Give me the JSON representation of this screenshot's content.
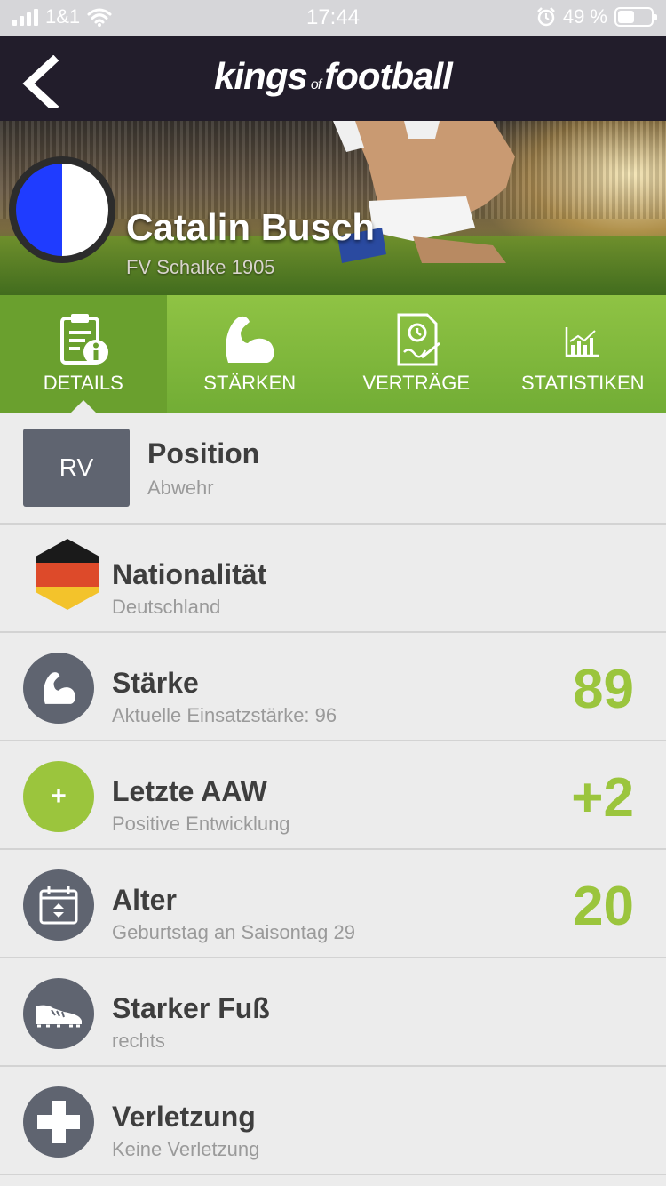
{
  "status_bar": {
    "carrier": "1&1",
    "time": "17:44",
    "battery": "49 %",
    "battery_level": 0.49
  },
  "header": {
    "logo_part1": "kings",
    "logo_of": "of",
    "logo_part2": "football"
  },
  "player": {
    "name": "Catalin Busch",
    "club": "FV Schalke 1905",
    "club_colors": [
      "#1f3cff",
      "#ffffff"
    ]
  },
  "tabs": [
    {
      "label": "DETAILS",
      "icon": "details-icon",
      "active": true
    },
    {
      "label": "STÄRKEN",
      "icon": "muscle-icon",
      "active": false
    },
    {
      "label": "VERTRÄGE",
      "icon": "contract-icon",
      "active": false
    },
    {
      "label": "STATISTIKEN",
      "icon": "chart-icon",
      "active": false
    }
  ],
  "details": [
    {
      "title": "Position",
      "sub": "Abwehr",
      "badge": "RV"
    },
    {
      "title": "Nationalität",
      "sub": "Deutschland",
      "icon": "germany-flag-icon"
    },
    {
      "title": "Stärke",
      "sub": "Aktuelle Einsatzstärke: 96",
      "value": "89",
      "icon": "muscle-icon"
    },
    {
      "title": "Letzte AAW",
      "sub": "Positive Entwicklung",
      "value": "+2",
      "icon": "plus-icon",
      "badge_symbol": "+"
    },
    {
      "title": "Alter",
      "sub": "Geburtstag an Saisontag 29",
      "value": "20",
      "icon": "calendar-icon"
    },
    {
      "title": "Starker Fuß",
      "sub": "rechts",
      "icon": "boot-icon"
    },
    {
      "title": "Verletzung",
      "sub": "Keine Verletzung",
      "icon": "medical-cross-icon"
    }
  ],
  "colors": {
    "accent_green": "#9bc53d",
    "nav_dark": "#221d2b",
    "icon_grey": "#5f6470"
  }
}
